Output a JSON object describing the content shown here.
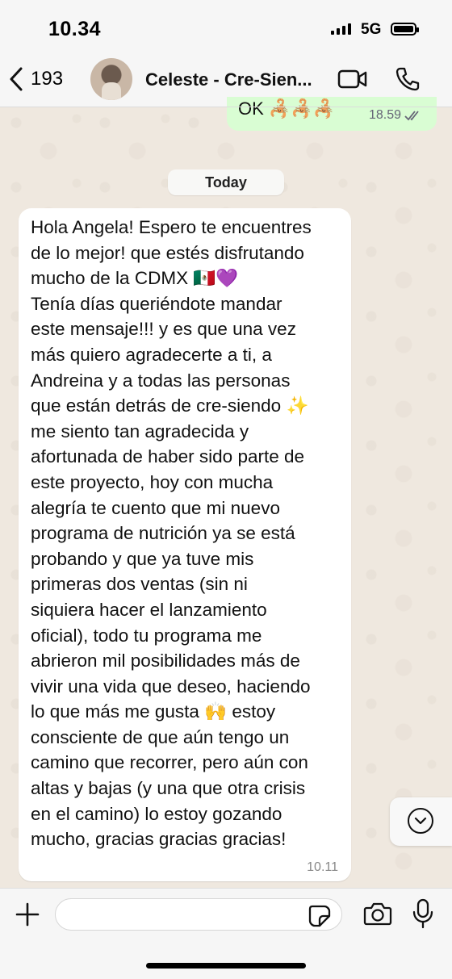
{
  "status_bar": {
    "time": "10.34",
    "network": "5G"
  },
  "header": {
    "back_count": "193",
    "contact_name": "Celeste - Cre-Sien..."
  },
  "previous_message": {
    "text": "OK 🦂🦂🦂",
    "time": "18.59"
  },
  "date_separator": "Today",
  "incoming_message": {
    "text": "Hola Angela! Espero te encuentres\nde lo mejor! que estés disfrutando\nmucho de la CDMX 🇲🇽💜\nTenía días queriéndote mandar\neste mensaje!!! y es que una vez\nmás quiero agradecerte a ti, a\nAndreina y a todas las personas\nque están detrás de cre-siendo ✨\nme siento tan agradecida y\nafortunada de haber sido parte de\neste proyecto, hoy con mucha\nalegría te cuento que mi nuevo\nprograma de nutrición ya se está\nprobando y que ya tuve mis\nprimeras dos ventas (sin ni\nsiquiera hacer el lanzamiento\noficial), todo tu programa me\nabrieron mil posibilidades más de\nvivir una vida que deseo, haciendo\nlo que más me gusta 🙌 estoy\nconsciente de que aún tengo un\ncamino que recorrer, pero aún con\naltas y bajas (y una que otra crisis\nen el camino) lo estoy gozando\nmucho, gracias gracias gracias!",
    "time": "10.11"
  },
  "input": {
    "placeholder": ""
  },
  "colors": {
    "outgoing_bubble": "#d9fdd3",
    "incoming_bubble": "#ffffff",
    "wallpaper": "#efe8df"
  },
  "icons": [
    "back-chevron-icon",
    "video-call-icon",
    "phone-icon",
    "double-check-icon",
    "chevron-down-icon",
    "plus-icon",
    "sticker-icon",
    "camera-icon",
    "mic-icon"
  ]
}
